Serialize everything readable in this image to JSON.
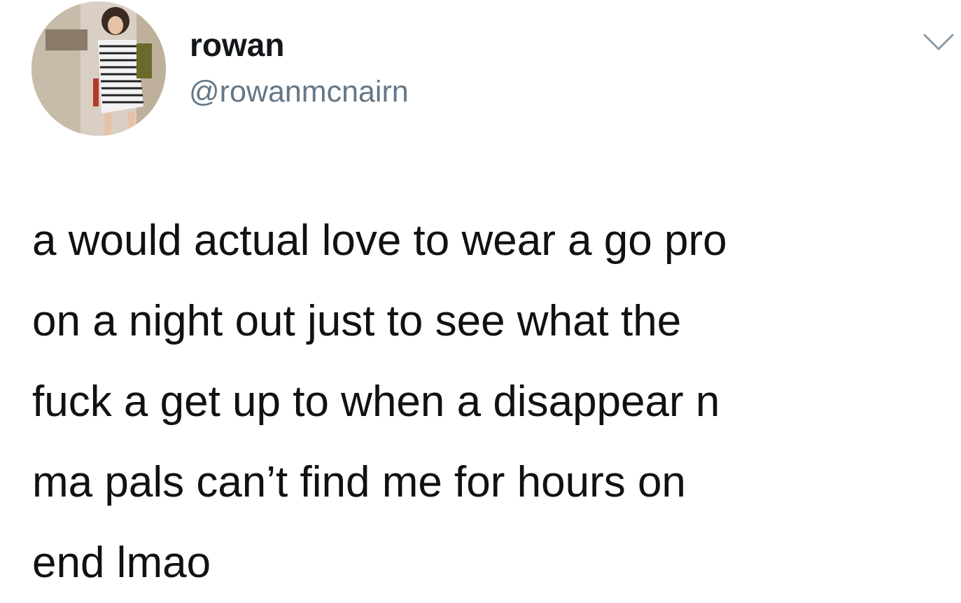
{
  "tweet": {
    "author": {
      "display_name": "rowan",
      "handle": "@rowanmcnairn",
      "avatar_icon": "profile-photo"
    },
    "menu_icon": "chevron-down-icon",
    "text_lines": [
      "a would actual love to wear a go pro",
      "on a night out just to see what the",
      "fuck a get up to when a disappear n",
      "ma pals can’t find me for hours on",
      "end lmao"
    ]
  },
  "colors": {
    "text": "#111111",
    "handle": "#657786",
    "background": "#ffffff"
  }
}
